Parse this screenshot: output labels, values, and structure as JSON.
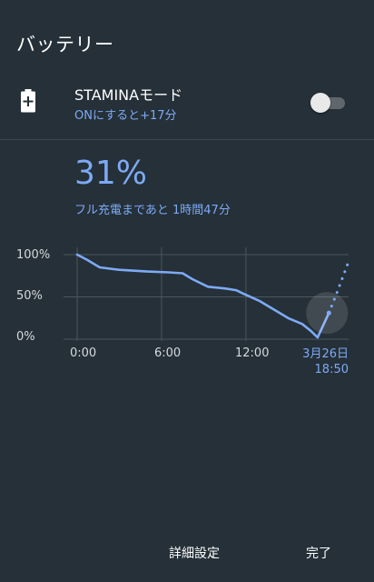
{
  "header": {
    "title": "バッテリー"
  },
  "stamina": {
    "label": "STAMINAモード",
    "sublabel": "ONにすると+17分",
    "toggle_on": false,
    "icon": "battery-saver-icon"
  },
  "status": {
    "percent": "31%",
    "charge_remaining": "フル充電まであと 1時間47分"
  },
  "chart_data": {
    "type": "line",
    "y_tick_labels": [
      "100%",
      "50%",
      "0%"
    ],
    "x_tick_labels": [
      "0:00",
      "6:00",
      "12:00"
    ],
    "current_date": "3月26日",
    "current_time": "18:50",
    "ylim": [
      0,
      100
    ],
    "xlim": [
      0,
      19.3
    ],
    "grid": true,
    "colors": {
      "line": "#7eaaf5",
      "grid": "#4c565d"
    },
    "series": [
      {
        "points": [
          [
            0,
            100
          ],
          [
            0.7,
            94
          ],
          [
            1.6,
            85
          ],
          [
            3,
            82
          ],
          [
            5,
            80
          ],
          [
            6.5,
            79
          ],
          [
            7.5,
            78
          ],
          [
            8.2,
            71
          ],
          [
            9.3,
            62
          ],
          [
            10.5,
            60
          ],
          [
            11.3,
            58
          ],
          [
            11.8,
            54
          ],
          [
            13,
            45
          ],
          [
            14.1,
            34
          ],
          [
            15,
            25
          ],
          [
            16,
            18
          ],
          [
            16.6,
            10
          ],
          [
            17.1,
            2
          ],
          [
            17.9,
            31
          ]
        ]
      },
      {
        "style": "dotted",
        "points": [
          [
            17.9,
            31
          ],
          [
            18.4,
            52
          ],
          [
            18.9,
            74
          ],
          [
            19.4,
            96
          ]
        ]
      }
    ]
  },
  "footer": {
    "details_label": "詳細設定",
    "done_label": "完了"
  }
}
